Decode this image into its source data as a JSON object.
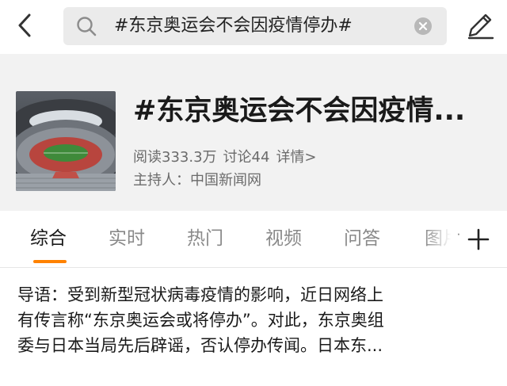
{
  "search": {
    "query": "#东京奥运会不会因疫情停办#"
  },
  "topic": {
    "title": "#东京奥运会不会因疫情...",
    "reads_label": "阅读333.3万",
    "discussions_label": "讨论44",
    "details_link": "详情>",
    "host_label": "主持人：中国新闻网"
  },
  "tabs": [
    {
      "label": "综合"
    },
    {
      "label": "实时"
    },
    {
      "label": "热门"
    },
    {
      "label": "视频"
    },
    {
      "label": "问答"
    },
    {
      "label": "图片"
    }
  ],
  "intro": {
    "lines": [
      "导语：受到新型冠状病毒疫情的影响，近日网络上",
      "有传言称“东京奥运会或将停办”。对此，东京奥组",
      "委与日本当局先后辟谣，否认停办传闻。日本东..."
    ]
  },
  "icons": {
    "back": "chevron-left-icon",
    "search": "search-icon",
    "clear": "clear-circle-icon",
    "edit": "pencil-icon",
    "add_tab": "plus-icon"
  },
  "colors": {
    "accent": "#ff8200",
    "header_bg": "#f2f2f2",
    "search_bg": "#ebebeb",
    "muted_text": "#8a8a8a"
  }
}
